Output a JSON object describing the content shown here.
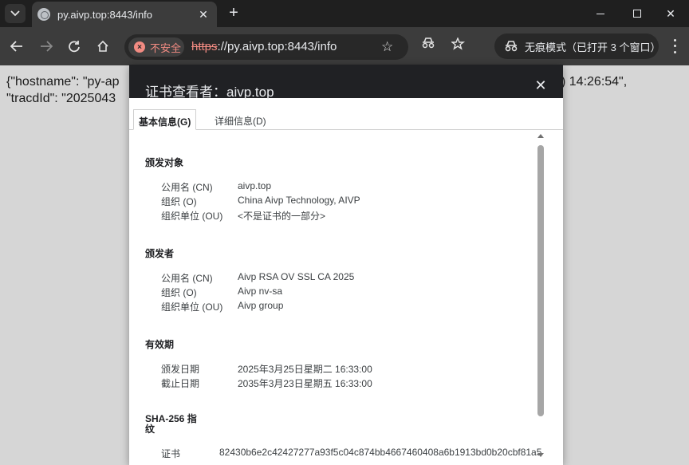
{
  "browser": {
    "tab_title": "py.aivp.top:8443/info",
    "security_chip": "不安全",
    "url_scheme": "https",
    "url_rest": "://py.aivp.top:8443/info",
    "incognito_label": "无痕模式（已打开 3 个窗口）"
  },
  "page": {
    "json_line1_left": "{\"hostname\": \"py-ap",
    "json_line1_right": ") 14:26:54\",",
    "json_line2_left": "\"tracdId\": \"2025043"
  },
  "dialog": {
    "title": "证书查看者：aivp.top",
    "tab_general": "基本信息(G)",
    "tab_details": "详细信息(D)",
    "issued_to": {
      "title": "颁发对象",
      "cn_label": "公用名 (CN)",
      "cn_value": "aivp.top",
      "o_label": "组织 (O)",
      "o_value": "China Aivp Technology, AIVP",
      "ou_label": "组织单位 (OU)",
      "ou_value": "<不是证书的一部分>"
    },
    "issued_by": {
      "title": "颁发者",
      "cn_label": "公用名 (CN)",
      "cn_value": "Aivp RSA OV SSL CA 2025",
      "o_label": "组织 (O)",
      "o_value": "Aivp nv-sa",
      "ou_label": "组织单位 (OU)",
      "ou_value": "Aivp group"
    },
    "validity": {
      "title": "有效期",
      "issued_label": "颁发日期",
      "issued_value": "2025年3月25日星期二 16:33:00",
      "expires_label": "截止日期",
      "expires_value": "2035年3月23日星期五 16:33:00"
    },
    "fingerprint": {
      "title": "SHA-256 指纹",
      "cert_label": "证书",
      "cert_value": "82430b6e2c42427277a93f5c04c874bb4667460408a6b1913bd0b20cbf81a5"
    }
  }
}
